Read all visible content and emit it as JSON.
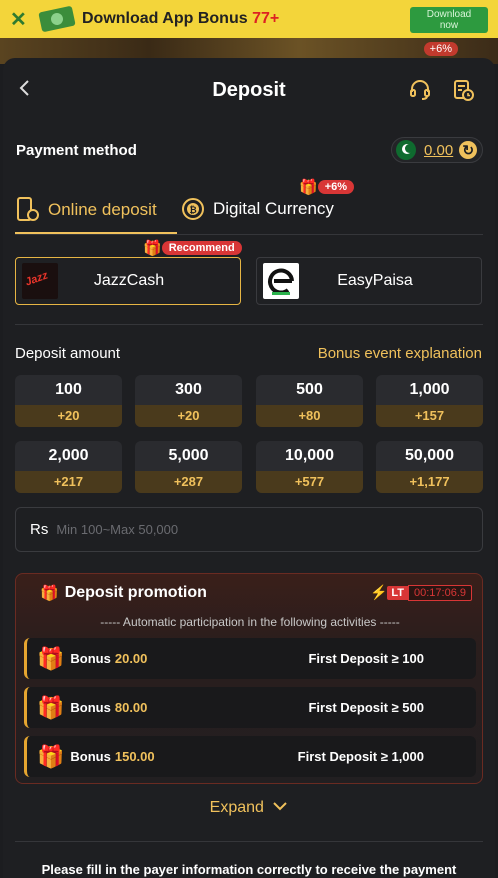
{
  "banner": {
    "title_prefix": "Download App Bonus ",
    "title_accent": "77+",
    "download_line1": "Download",
    "download_line2": "now",
    "bg_pill": "+6%"
  },
  "header": {
    "title": "Deposit"
  },
  "payment": {
    "label": "Payment method",
    "balance": "0.00"
  },
  "tabs": [
    {
      "label": "Online deposit",
      "active": true
    },
    {
      "label": "Digital Currency",
      "badge": "+6%"
    }
  ],
  "channels": [
    {
      "name": "JazzCash",
      "badge": "Recommend",
      "active": true
    },
    {
      "name": "EasyPaisa"
    }
  ],
  "deposit": {
    "label": "Deposit amount",
    "bonus_link": "Bonus event explanation",
    "amounts": [
      {
        "value": "100",
        "bonus": "+20"
      },
      {
        "value": "300",
        "bonus": "+20"
      },
      {
        "value": "500",
        "bonus": "+80"
      },
      {
        "value": "1,000",
        "bonus": "+157"
      },
      {
        "value": "2,000",
        "bonus": "+217"
      },
      {
        "value": "5,000",
        "bonus": "+287"
      },
      {
        "value": "10,000",
        "bonus": "+577"
      },
      {
        "value": "50,000",
        "bonus": "+1,177"
      }
    ],
    "currency": "Rs",
    "placeholder": "Min 100~Max 50,000"
  },
  "promotion": {
    "title": "Deposit promotion",
    "lt_tag": "LT",
    "timer": "00:17:06.9",
    "subtitle": "----- Automatic participation in the following activities -----",
    "rows": [
      {
        "bonus_label": "Bonus",
        "bonus_value": "20.00",
        "condition": "First Deposit ≥ 100"
      },
      {
        "bonus_label": "Bonus",
        "bonus_value": "80.00",
        "condition": "First Deposit ≥ 500"
      },
      {
        "bonus_label": "Bonus",
        "bonus_value": "150.00",
        "condition": "First Deposit ≥ 1,000"
      }
    ]
  },
  "expand_label": "Expand",
  "footer_note": "Please fill in the payer information correctly to receive the payment"
}
